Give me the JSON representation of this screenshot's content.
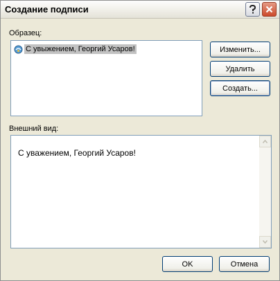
{
  "window": {
    "title": "Создание подписи"
  },
  "titlebar": {
    "help_label": "?",
    "close_label": "×"
  },
  "sample": {
    "label": "Образец:",
    "items": [
      {
        "text": "С увыжением, Георгий Усаров!"
      }
    ]
  },
  "buttons": {
    "edit": "Изменить...",
    "delete": "Удалить",
    "create": "Создать...",
    "ok": "OK",
    "cancel": "Отмена"
  },
  "preview": {
    "label": "Внешний вид:",
    "text": "С уважением, Георгий Усаров!"
  },
  "colors": {
    "dialog_bg": "#ece9d8",
    "selection": "#c2c2c2",
    "close_button": "#cc4a2b",
    "border": "#7f9db9"
  }
}
